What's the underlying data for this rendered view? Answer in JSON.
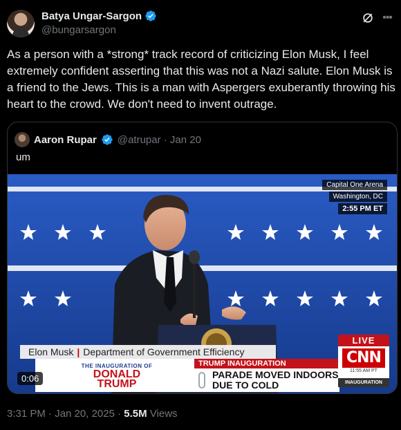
{
  "author": {
    "name": "Batya Ungar-Sargon",
    "handle": "@bungarsargon",
    "verified": true,
    "avatar_icon": "profile-photo"
  },
  "tweet": {
    "text": "As a person with a *strong* track record of criticizing Elon Musk, I feel extremely confident asserting that this was not a Nazi salute. Elon Musk is a friend to the Jews. This is a man with Aspergers exuberantly throwing his heart to the crowd. We don't need to invent outrage."
  },
  "quote": {
    "name": "Aaron Rupar",
    "handle_date": "@atrupar · Jan 20",
    "text": "um",
    "video": {
      "location_venue": "Capital One Arena",
      "location_city": "Washington, DC",
      "location_time": "2:55 PM ET",
      "lower_third_name": "Elon Musk",
      "lower_third_title": "Department of Government Efficiency",
      "inaug_small": "THE INAUGURATION OF",
      "inaug_name_1": "DONALD",
      "inaug_name_2": "TRUMP",
      "strip_label": "TRUMP INAUGURATION",
      "headline": "PARADE MOVED INDOORS DUE TO COLD",
      "live_label": "LIVE",
      "network": "CNN",
      "network_time": "11:55 AM PT",
      "network_tag": "INAUGURATION",
      "duration": "0:06"
    }
  },
  "footer": {
    "time_date": "3:31 PM · Jan 20, 2025 · ",
    "views_count": "5.5M",
    "views_label": " Views"
  },
  "colors": {
    "background": "#000000",
    "text_primary": "#e7e9ea",
    "text_secondary": "#71767b",
    "verified_blue": "#1d9bf0",
    "cnn_red": "#cc0000"
  }
}
